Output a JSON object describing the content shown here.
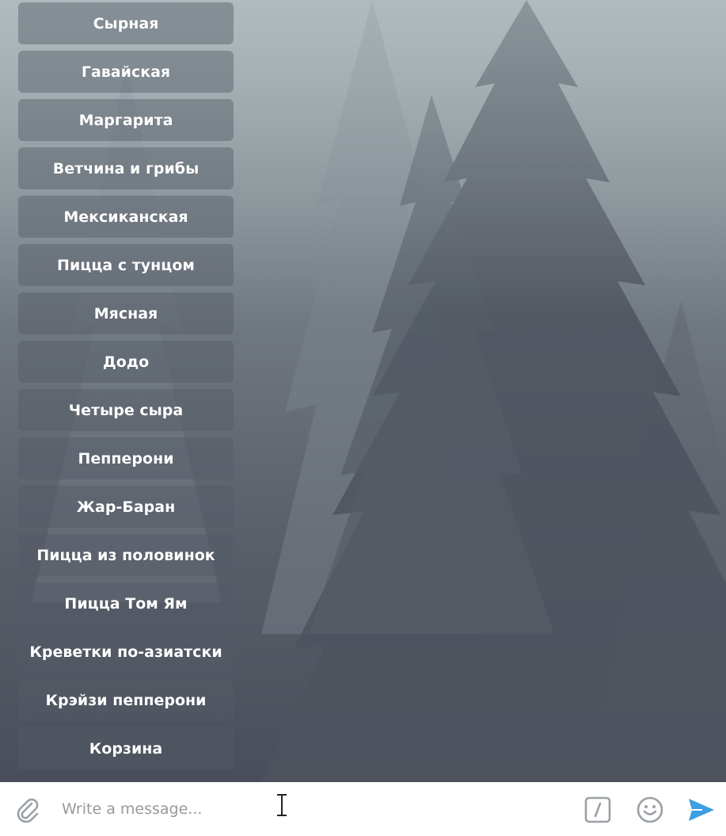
{
  "keyboard": {
    "buttons": [
      {
        "label": "Сырная"
      },
      {
        "label": "Гавайская"
      },
      {
        "label": "Маргарита"
      },
      {
        "label": "Ветчина и грибы"
      },
      {
        "label": "Мексиканская"
      },
      {
        "label": "Пицца с тунцом"
      },
      {
        "label": "Мясная"
      },
      {
        "label": "Додо"
      },
      {
        "label": "Четыре сыра"
      },
      {
        "label": "Пепперони"
      },
      {
        "label": "Жар-Баран"
      },
      {
        "label": "Пицца из половинок"
      },
      {
        "label": "Пицца Том Ям"
      },
      {
        "label": "Креветки по-азиатски"
      },
      {
        "label": "Крэйзи пепперони"
      },
      {
        "label": "Корзина"
      }
    ]
  },
  "composer": {
    "placeholder": "Write a message...",
    "icons": {
      "attach": "paperclip-icon",
      "commands": "slash-command-icon",
      "emoji": "smiley-icon",
      "send": "send-icon"
    }
  },
  "colors": {
    "send_accent": "#3d9ee3",
    "icon_gray": "#9aa0a6"
  }
}
